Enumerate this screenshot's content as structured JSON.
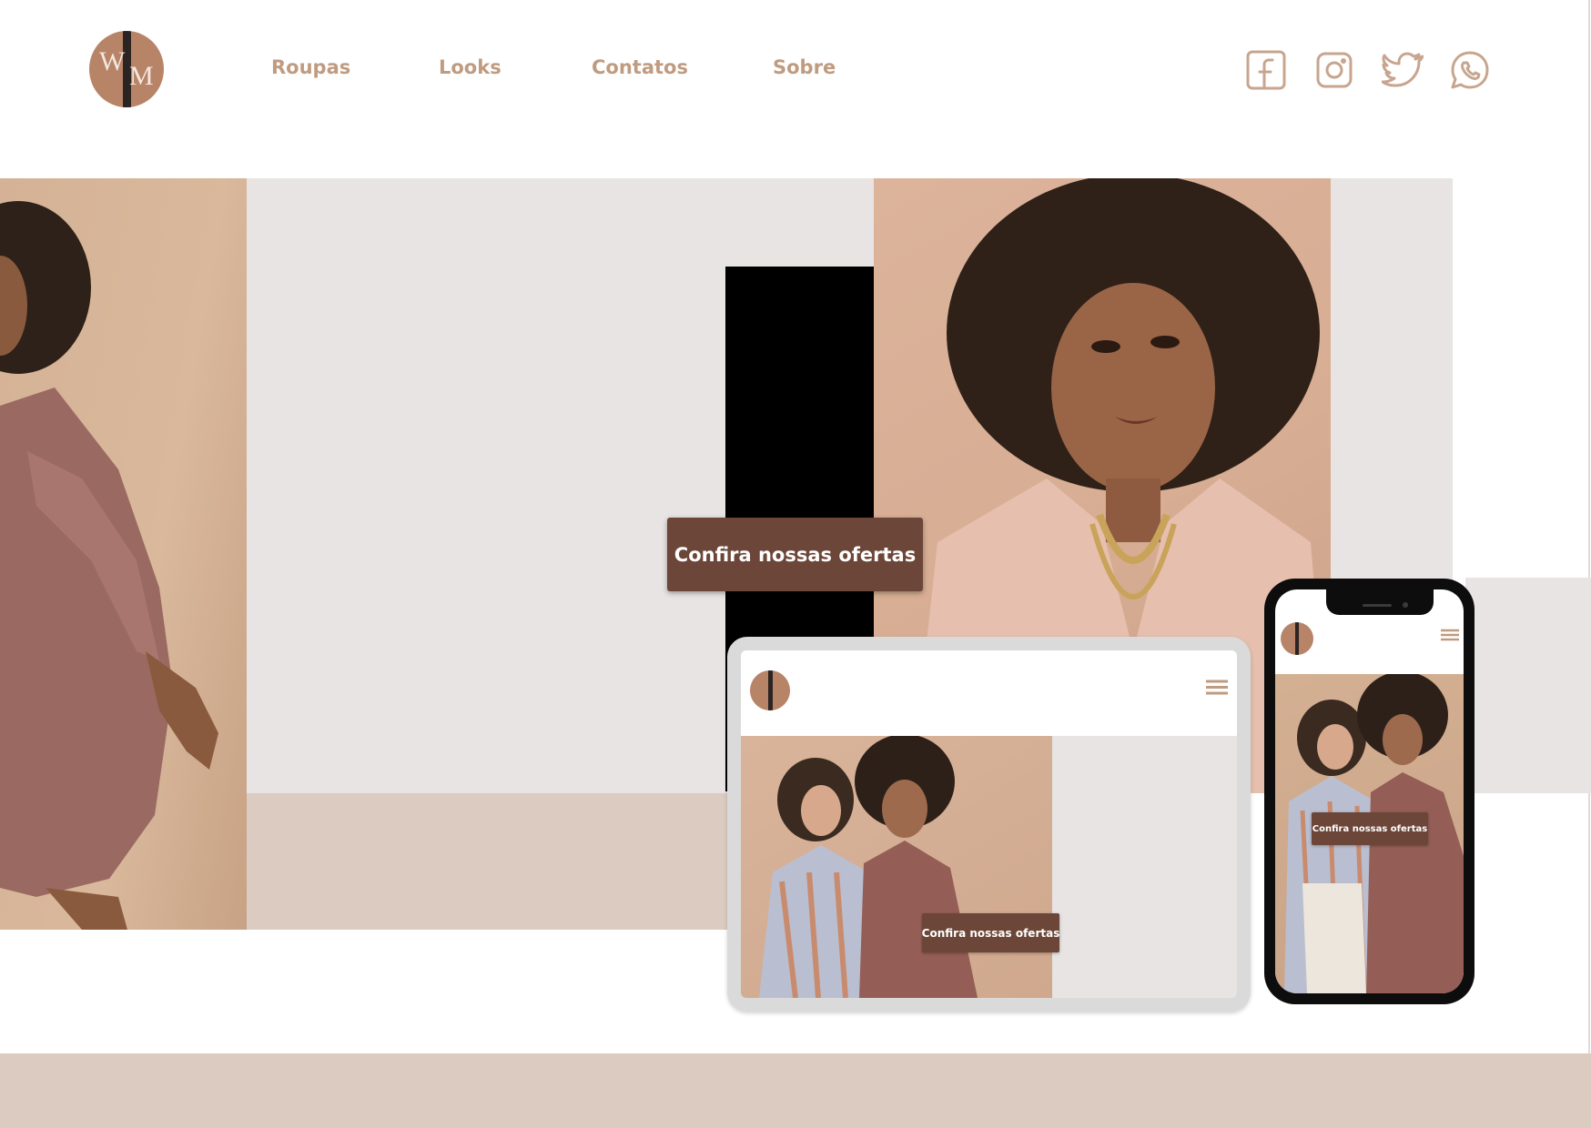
{
  "brand": {
    "logo_letters": "WM",
    "colors": {
      "brown_cta": "#6c4638",
      "logo_bg": "#b88468",
      "nav_text": "#bf9b80",
      "panel_grey": "#e7e4e3",
      "panel_pink": "#dccbc1",
      "icon_stroke": "#c7a58e"
    }
  },
  "nav": {
    "items": [
      {
        "label": "Roupas"
      },
      {
        "label": "Looks"
      },
      {
        "label": "Contatos"
      },
      {
        "label": "Sobre"
      }
    ]
  },
  "social": {
    "icons": [
      "facebook-icon",
      "instagram-icon",
      "twitter-icon",
      "whatsapp-icon"
    ]
  },
  "hero": {
    "cta_label": "Confira nossas ofertas"
  },
  "tablet": {
    "cta_label": "Confira nossas ofertas",
    "menu_icon": "hamburger-icon"
  },
  "phone": {
    "cta_label": "Confira nossas ofertas",
    "menu_icon": "hamburger-icon"
  }
}
